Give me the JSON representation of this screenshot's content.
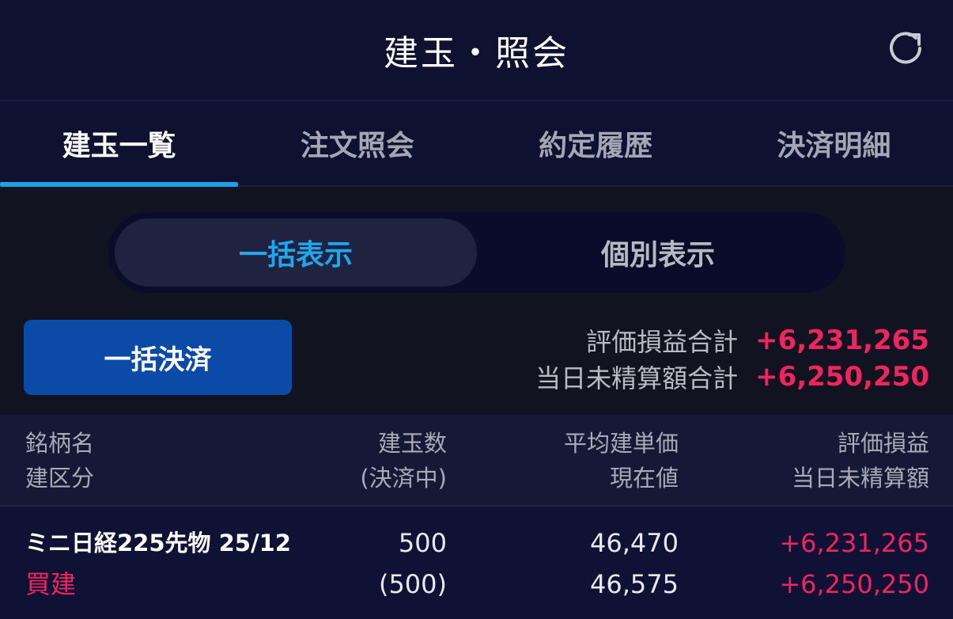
{
  "header": {
    "title": "建玉・照会",
    "refresh_icon": "refresh-icon"
  },
  "tabs": [
    {
      "label": "建玉一覧",
      "active": true
    },
    {
      "label": "注文照会",
      "active": false
    },
    {
      "label": "約定履歴",
      "active": false
    },
    {
      "label": "決済明細",
      "active": false
    }
  ],
  "display_toggle": {
    "bulk_label": "一括表示",
    "individual_label": "個別表示",
    "selected": "一括表示"
  },
  "actions": {
    "bulk_settle_label": "一括決済"
  },
  "summary": {
    "pl_total_label": "評価損益合計",
    "pl_total_value": "+6,231,265",
    "unsettled_total_label": "当日未精算額合計",
    "unsettled_total_value": "+6,250,250"
  },
  "table": {
    "headers": {
      "col1_line1": "銘柄名",
      "col1_line2": "建区分",
      "col2_line1": "建玉数",
      "col2_line2": "(決済中)",
      "col3_line1": "平均建単価",
      "col3_line2": "現在値",
      "col4_line1": "評価損益",
      "col4_line2": "当日未精算額"
    },
    "rows": [
      {
        "name": "ミニ日経225先物 25/12",
        "side": "買建",
        "quantity": "500",
        "settling": "(500)",
        "avg_price": "46,470",
        "current_price": "46,575",
        "pl": "+6,231,265",
        "unsettled": "+6,250,250"
      }
    ]
  },
  "colors": {
    "background": "#0f1126",
    "accent_blue": "#1ea0e6",
    "button_blue": "#0b4aa6",
    "positive_red": "#f0245e"
  }
}
